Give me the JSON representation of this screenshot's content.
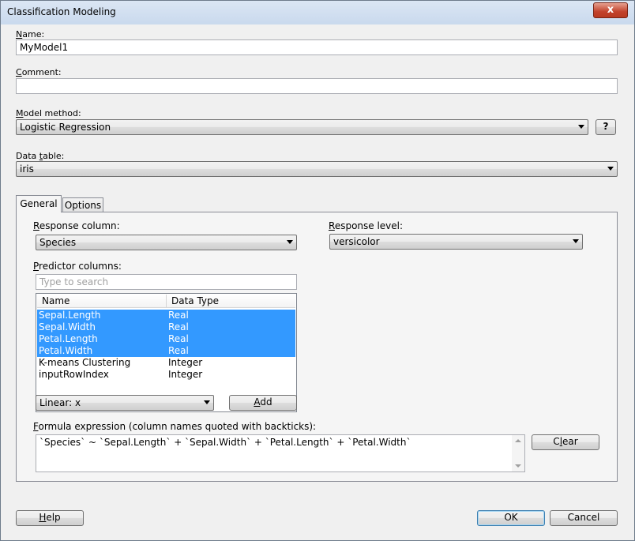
{
  "window": {
    "title": "Classification Modeling",
    "close_label": "x"
  },
  "name": {
    "label_ul": "N",
    "label_rest": "ame:",
    "value": "MyModel1"
  },
  "comment": {
    "label_ul": "C",
    "label_rest": "omment:",
    "value": ""
  },
  "model_method": {
    "label_pre": "",
    "label_ul": "M",
    "label_rest": "odel method:",
    "value": "Logistic Regression",
    "help_label": "?"
  },
  "data_table": {
    "label_pre": "Data ",
    "label_ul": "t",
    "label_rest": "able:",
    "value": "iris"
  },
  "tabs": [
    {
      "label": "General",
      "active": true
    },
    {
      "label": "Options",
      "active": false
    }
  ],
  "general": {
    "response_column": {
      "label_ul": "R",
      "label_rest": "esponse column:",
      "value": "Species"
    },
    "response_level": {
      "label_ul": "R",
      "label_rest": "esponse level:",
      "value": "versicolor"
    },
    "predictor_columns": {
      "label_ul": "P",
      "label_rest": "redictor columns:",
      "search_placeholder": "Type to search"
    },
    "list": {
      "headers": [
        "Name",
        "Data Type"
      ],
      "rows": [
        {
          "name": "Sepal.Length",
          "type": "Real",
          "selected": true
        },
        {
          "name": "Sepal.Width",
          "type": "Real",
          "selected": true
        },
        {
          "name": "Petal.Length",
          "type": "Real",
          "selected": true
        },
        {
          "name": "Petal.Width",
          "type": "Real",
          "selected": true
        },
        {
          "name": "K-means Clustering",
          "type": "Integer",
          "selected": false
        },
        {
          "name": "inputRowIndex",
          "type": "Integer",
          "selected": false
        }
      ]
    },
    "term_type": {
      "value": "Linear: x"
    },
    "add_button": {
      "label_ul": "A",
      "label_rest": "dd"
    },
    "formula": {
      "label_ul": "F",
      "label_rest": "ormula expression (column names quoted with backticks):",
      "value": "`Species` ~ `Sepal.Length` + `Sepal.Width` + `Petal.Length` + `Petal.Width`"
    },
    "clear_button": {
      "label_pre": "C",
      "label_ul": "l",
      "label_rest": "ear"
    }
  },
  "footer": {
    "help": {
      "label_ul": "H",
      "label_rest": "elp"
    },
    "ok": {
      "label": "OK"
    },
    "cancel": {
      "label": "Cancel"
    }
  },
  "colors": {
    "selection": "#3399ff",
    "titlebar": "#c9d9ed",
    "close": "#c2422b"
  }
}
